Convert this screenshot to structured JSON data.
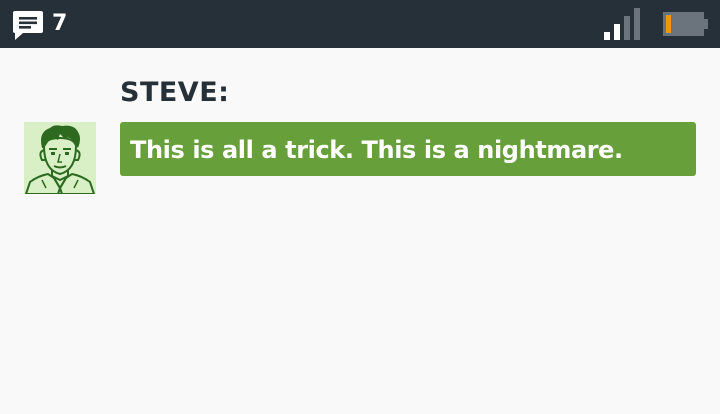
{
  "status_bar": {
    "message_icon": "chat-bubble-icon",
    "message_count": "7",
    "signal_icon": "signal-strength-icon",
    "battery_icon": "battery-low-icon"
  },
  "dialogue": {
    "speaker": "STEVE:",
    "portrait_icon": "steve-portrait",
    "text": "This is all a trick. This is a nightmare."
  },
  "colors": {
    "status_bar_bg": "#263039",
    "background": "#f9f9f9",
    "speaker_text": "#263039",
    "bubble_bg": "#67a03a",
    "portrait_bg": "#d9efc6",
    "portrait_ink": "#2d6a1f",
    "battery_level": "#f0960f",
    "signal_dim": "#6b747c"
  }
}
